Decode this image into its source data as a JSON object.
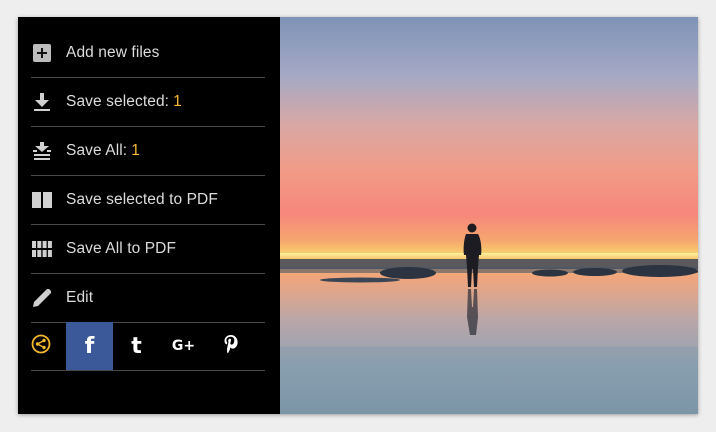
{
  "menu": {
    "items": [
      {
        "label": "Add new files",
        "count": "",
        "icon": "add-file-icon"
      },
      {
        "label": "Save selected:",
        "count": "1",
        "icon": "download-icon"
      },
      {
        "label": "Save All:",
        "count": "1",
        "icon": "download-all-icon"
      },
      {
        "label": "Save selected to PDF",
        "count": "",
        "icon": "pdf-two-pages-icon"
      },
      {
        "label": "Save All to PDF",
        "count": "",
        "icon": "pdf-grid-icon"
      },
      {
        "label": "Edit",
        "count": "",
        "icon": "pencil-icon"
      }
    ]
  },
  "share": {
    "buttons": [
      {
        "name": "share",
        "glyph": "",
        "icon": "share-icon"
      },
      {
        "name": "facebook",
        "glyph": "f",
        "icon": "facebook-icon"
      },
      {
        "name": "tumblr",
        "glyph": "t",
        "icon": "tumblr-icon"
      },
      {
        "name": "google-plus",
        "glyph": "G+",
        "icon": "google-plus-icon"
      },
      {
        "name": "pinterest",
        "glyph": "P",
        "icon": "pinterest-icon"
      }
    ]
  },
  "colors": {
    "panel_bg": "#000000",
    "accent": "#f5b82e",
    "facebook": "#3b5998",
    "label_text": "#dcdcdc"
  },
  "image": {
    "subject": "silhouette of a person standing in shallow water at sunset"
  }
}
